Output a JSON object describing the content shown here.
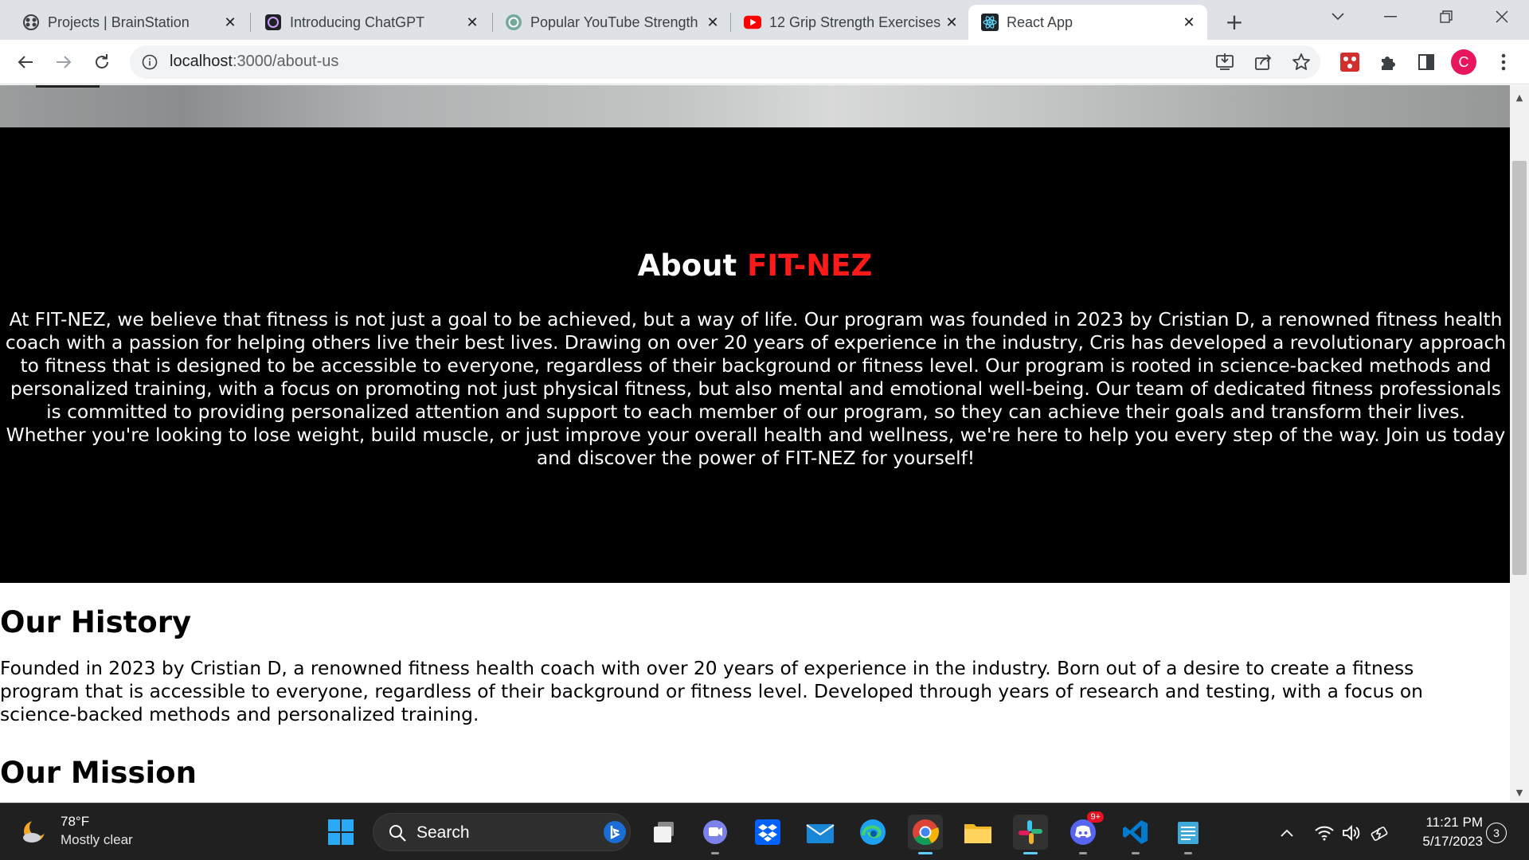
{
  "browser": {
    "tabs": [
      {
        "title": "Projects | BrainStation",
        "icon": "brainstation-icon"
      },
      {
        "title": "Introducing ChatGPT",
        "icon": "openai-icon"
      },
      {
        "title": "Popular YouTube Strength",
        "icon": "openai-icon"
      },
      {
        "title": "12 Grip Strength Exercises",
        "icon": "youtube-icon"
      },
      {
        "title": "React App",
        "icon": "react-icon"
      }
    ],
    "active_tab": 4,
    "url": {
      "host": "localhost",
      "path": ":3000/about-us"
    },
    "profile_initial": "C"
  },
  "page": {
    "about": {
      "heading_prefix": "About ",
      "brand": "FIT-NEZ",
      "body": "At FIT-NEZ, we believe that fitness is not just a goal to be achieved, but a way of life. Our program was founded in 2023 by Cristian D, a renowned fitness health coach with a passion for helping others live their best lives. Drawing on over 20 years of experience in the industry, Cris has developed a revolutionary approach to fitness that is designed to be accessible to everyone, regardless of their background or fitness level. Our program is rooted in science-backed methods and personalized training, with a focus on promoting not just physical fitness, but also mental and emotional well-being. Our team of dedicated fitness professionals is committed to providing personalized attention and support to each member of our program, so they can achieve their goals and transform their lives. Whether you're looking to lose weight, build muscle, or just improve your overall health and wellness, we're here to help you every step of the way. Join us today and discover the power of FIT-NEZ for yourself!"
    },
    "history": {
      "heading": "Our History",
      "body": "Founded in 2023 by Cristian D, a renowned fitness health coach with over 20 years of experience in the industry. Born out of a desire to create a fitness program that is accessible to everyone, regardless of their background or fitness level. Developed through years of research and testing, with a focus on science-backed methods and personalized training."
    },
    "mission": {
      "heading": "Our Mission"
    },
    "colors": {
      "brand_red": "#ff1a1a",
      "hero_bg": "#000000"
    }
  },
  "taskbar": {
    "weather": {
      "temp": "78°F",
      "condition": "Mostly clear"
    },
    "search_label": "Search",
    "discord_badge": "9+",
    "time": "11:21 PM",
    "date": "5/17/2023",
    "notifications": "3"
  }
}
